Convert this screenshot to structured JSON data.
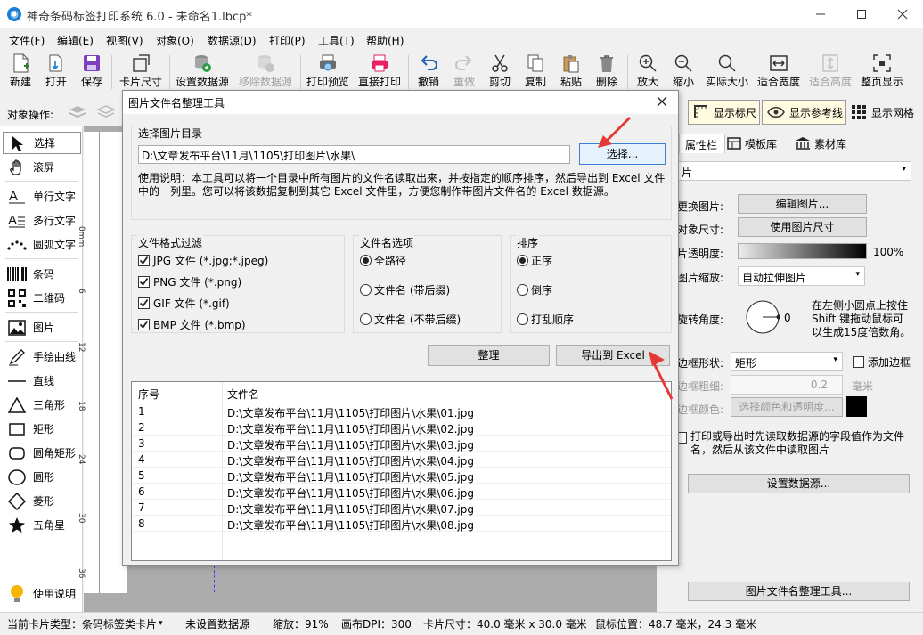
{
  "window": {
    "title": "神奇条码标签打印系统 6.0 - 未命名1.lbcp*"
  },
  "menu": [
    "文件(F)",
    "编辑(E)",
    "视图(V)",
    "对象(O)",
    "数据源(D)",
    "打印(P)",
    "工具(T)",
    "帮助(H)"
  ],
  "toolbar": [
    {
      "label": "新建",
      "icon": "new-file-icon",
      "enabled": true
    },
    {
      "label": "打开",
      "icon": "open-icon",
      "enabled": true
    },
    {
      "label": "保存",
      "icon": "save-icon",
      "enabled": true
    },
    {
      "label": "卡片尺寸",
      "icon": "card-size-icon",
      "enabled": true
    },
    {
      "label": "设置数据源",
      "icon": "database-icon",
      "enabled": true
    },
    {
      "label": "移除数据源",
      "icon": "database-remove-icon",
      "enabled": false
    },
    {
      "label": "打印预览",
      "icon": "print-preview-icon",
      "enabled": true
    },
    {
      "label": "直接打印",
      "icon": "printer-icon",
      "enabled": true
    },
    {
      "label": "撤销",
      "icon": "undo-icon",
      "enabled": true
    },
    {
      "label": "重做",
      "icon": "redo-icon",
      "enabled": false
    },
    {
      "label": "剪切",
      "icon": "scissors-icon",
      "enabled": true
    },
    {
      "label": "复制",
      "icon": "copy-icon",
      "enabled": true
    },
    {
      "label": "粘贴",
      "icon": "paste-icon",
      "enabled": true
    },
    {
      "label": "删除",
      "icon": "trash-icon",
      "enabled": true
    },
    {
      "label": "放大",
      "icon": "zoom-in-icon",
      "enabled": true
    },
    {
      "label": "缩小",
      "icon": "zoom-out-icon",
      "enabled": true
    },
    {
      "label": "实际大小",
      "icon": "zoom-actual-icon",
      "enabled": true
    },
    {
      "label": "适合宽度",
      "icon": "fit-width-icon",
      "enabled": true
    },
    {
      "label": "适合高度",
      "icon": "fit-height-icon",
      "enabled": false
    },
    {
      "label": "整页显示",
      "icon": "fit-page-icon",
      "enabled": true
    }
  ],
  "object_bar": {
    "label": "对象操作:"
  },
  "view_toggles": {
    "ruler": "显示标尺",
    "guides": "显示参考线",
    "grid": "显示网格"
  },
  "left_tools": [
    {
      "label": "选择",
      "icon": "pointer-icon",
      "selected": true
    },
    {
      "label": "滚屏",
      "icon": "hand-icon"
    },
    {
      "label": "单行文字",
      "icon": "single-line-text-icon"
    },
    {
      "label": "多行文字",
      "icon": "multi-line-text-icon"
    },
    {
      "label": "圆弧文字",
      "icon": "arc-text-icon"
    },
    {
      "label": "条码",
      "icon": "barcode-icon"
    },
    {
      "label": "二维码",
      "icon": "qrcode-icon"
    },
    {
      "label": "图片",
      "icon": "image-icon"
    },
    {
      "label": "手绘曲线",
      "icon": "pen-icon"
    },
    {
      "label": "直线",
      "icon": "line-icon"
    },
    {
      "label": "三角形",
      "icon": "triangle-icon"
    },
    {
      "label": "矩形",
      "icon": "rectangle-icon"
    },
    {
      "label": "圆角矩形",
      "icon": "rounded-rectangle-icon"
    },
    {
      "label": "圆形",
      "icon": "circle-icon"
    },
    {
      "label": "菱形",
      "icon": "diamond-icon"
    },
    {
      "label": "五角星",
      "icon": "star-icon"
    }
  ],
  "help_label": "使用说明",
  "ruler_marks": [
    "0mm",
    "6",
    "12",
    "18",
    "24",
    "30",
    "36"
  ],
  "right_panel": {
    "tabs": [
      "属性栏",
      "模板库",
      "素材库"
    ],
    "object_type": "片",
    "replace_image_label": "更换图片:",
    "edit_image_button": "编辑图片...",
    "object_size_label": "对象尺寸:",
    "use_image_size_button": "使用图片尺寸",
    "opacity_label": "片透明度:",
    "opacity_value": "100%",
    "scale_label": "图片缩放:",
    "scale_value": "自动拉伸图片",
    "rotate_label": "旋转角度:",
    "rotate_value": "0",
    "rotate_hint": "在左侧小圆点上按住Shift 键拖动鼠标可以生成15度倍数角。",
    "border_shape_label": "边框形状:",
    "border_shape_value": "矩形",
    "add_border_label": "添加边框",
    "border_width_label": "边框粗细:",
    "border_width_value": "0.2",
    "border_width_unit": "毫米",
    "border_color_label": "边框颜色:",
    "border_color_button": "选择颜色和透明度...",
    "read_from_file_label": "打印或导出时先读取数据源的字段值作为文件名，然后从该文件中读取图片",
    "set_datasource_button": "设置数据源...",
    "image_tool_button": "图片文件名整理工具..."
  },
  "dialog": {
    "title": "图片文件名整理工具",
    "dir_group": "选择图片目录",
    "dir_path": "D:\\文章发布平台\\11月\\1105\\打印图片\\水果\\",
    "choose_button": "选择...",
    "description": "使用说明：本工具可以将一个目录中所有图片的文件名读取出来，并按指定的顺序排序，然后导出到 Excel 文件中的一列里。您可以将该数据复制到其它 Excel 文件里，方便您制作带图片文件名的 Excel 数据源。",
    "format_group": "文件格式过滤",
    "formats": [
      "JPG 文件 (*.jpg;*.jpeg)",
      "PNG 文件 (*.png)",
      "GIF 文件 (*.gif)",
      "BMP 文件 (*.bmp)"
    ],
    "name_group": "文件名选项",
    "name_options": [
      "全路径",
      "文件名 (带后缀)",
      "文件名 (不带后缀)"
    ],
    "name_selected": 0,
    "sort_group": "排序",
    "sort_options": [
      "正序",
      "倒序",
      "打乱顺序"
    ],
    "sort_selected": 0,
    "organize_button": "整理",
    "export_button": "导出到 Excel",
    "columns": [
      "序号",
      "文件名"
    ],
    "rows": [
      [
        "1",
        "D:\\文章发布平台\\11月\\1105\\打印图片\\水果\\01.jpg"
      ],
      [
        "2",
        "D:\\文章发布平台\\11月\\1105\\打印图片\\水果\\02.jpg"
      ],
      [
        "3",
        "D:\\文章发布平台\\11月\\1105\\打印图片\\水果\\03.jpg"
      ],
      [
        "4",
        "D:\\文章发布平台\\11月\\1105\\打印图片\\水果\\04.jpg"
      ],
      [
        "5",
        "D:\\文章发布平台\\11月\\1105\\打印图片\\水果\\05.jpg"
      ],
      [
        "6",
        "D:\\文章发布平台\\11月\\1105\\打印图片\\水果\\06.jpg"
      ],
      [
        "7",
        "D:\\文章发布平台\\11月\\1105\\打印图片\\水果\\07.jpg"
      ],
      [
        "8",
        "D:\\文章发布平台\\11月\\1105\\打印图片\\水果\\08.jpg"
      ]
    ]
  },
  "status": {
    "card_type": "当前卡片类型：条码标签类卡片",
    "datasource": "未设置数据源",
    "zoom": "缩放：91%",
    "dpi": "画布DPI：300",
    "card_size": "卡片尺寸：40.0 毫米 x 30.0 毫米",
    "mouse_pos": "鼠标位置：48.7 毫米，24.3 毫米"
  },
  "colors": {
    "accent": "#1a7fd4",
    "arrow": "#e53935",
    "print_icon": "#e91e63",
    "save_icon": "#7b3fbf"
  }
}
